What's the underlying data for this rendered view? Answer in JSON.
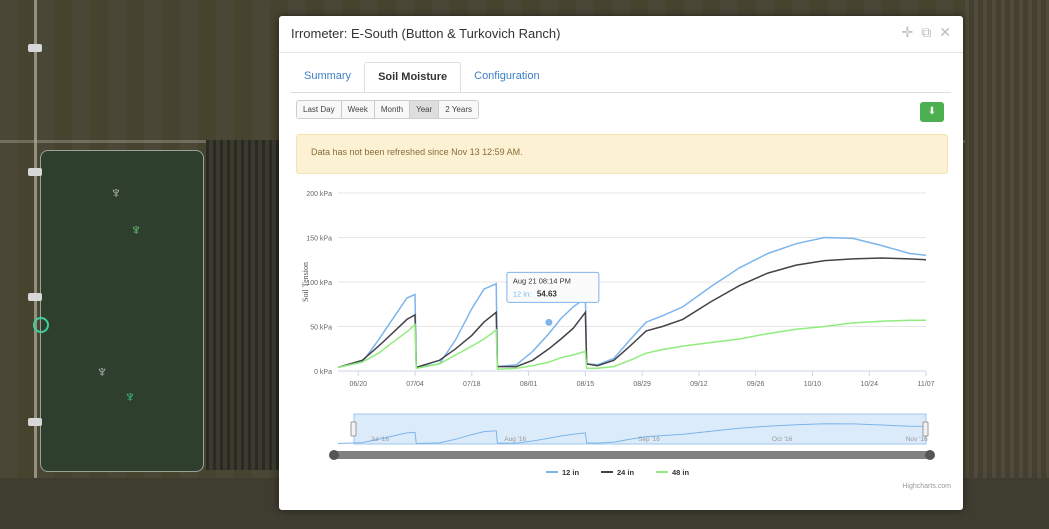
{
  "modal": {
    "title": "Irrometer: E-South (Button & Turkovich Ranch)",
    "actions": [
      {
        "name": "move-icon",
        "glyph": "✛"
      },
      {
        "name": "copy-icon",
        "glyph": "⧉"
      },
      {
        "name": "close-icon",
        "glyph": "✕"
      }
    ]
  },
  "tabs": [
    {
      "label": "Summary",
      "active": false
    },
    {
      "label": "Soil Moisture",
      "active": true
    },
    {
      "label": "Configuration",
      "active": false
    }
  ],
  "range_buttons": [
    {
      "label": "Last Day",
      "active": false
    },
    {
      "label": "Week",
      "active": false
    },
    {
      "label": "Month",
      "active": false
    },
    {
      "label": "Year",
      "active": true
    },
    {
      "label": "2 Years",
      "active": false
    }
  ],
  "download_icon": "download-icon",
  "alert": {
    "text": "Data has not been refreshed since Nov 13 12:59 AM."
  },
  "chart_data": {
    "type": "line",
    "ylabel": "Soil Tension",
    "y_ticks": [
      "0 kPa",
      "50 kPa",
      "100 kPa",
      "150 kPa",
      "200 kPa"
    ],
    "ylim": [
      0,
      200
    ],
    "x_ticks": [
      "06/20",
      "07/04",
      "07/18",
      "08/01",
      "08/15",
      "08/29",
      "09/12",
      "09/26",
      "10/10",
      "10/24",
      "11/07"
    ],
    "series": [
      {
        "name": "12 in",
        "color": "#7cb5ec",
        "points": [
          [
            0,
            4
          ],
          [
            6,
            10
          ],
          [
            10,
            35
          ],
          [
            14,
            62
          ],
          [
            17,
            82
          ],
          [
            19,
            86
          ],
          [
            19.3,
            4
          ],
          [
            25,
            8
          ],
          [
            29,
            35
          ],
          [
            33,
            70
          ],
          [
            36,
            92
          ],
          [
            39,
            98
          ],
          [
            39.3,
            5
          ],
          [
            44,
            7
          ],
          [
            48,
            22
          ],
          [
            52,
            42
          ],
          [
            55,
            59
          ],
          [
            58,
            72
          ],
          [
            61,
            82
          ],
          [
            61.3,
            8
          ],
          [
            64,
            7
          ],
          [
            68,
            14
          ],
          [
            72,
            35
          ],
          [
            76,
            55
          ],
          [
            80,
            62
          ],
          [
            85,
            72
          ],
          [
            92,
            95
          ],
          [
            99,
            116
          ],
          [
            106,
            132
          ],
          [
            113,
            143
          ],
          [
            120,
            150
          ],
          [
            127,
            149
          ],
          [
            134,
            141
          ],
          [
            141,
            132
          ],
          [
            145,
            130
          ]
        ]
      },
      {
        "name": "24 in",
        "color": "#434348",
        "points": [
          [
            0,
            4
          ],
          [
            6,
            12
          ],
          [
            10,
            28
          ],
          [
            14,
            45
          ],
          [
            17,
            58
          ],
          [
            19,
            63
          ],
          [
            19.3,
            4
          ],
          [
            25,
            12
          ],
          [
            29,
            25
          ],
          [
            33,
            40
          ],
          [
            36,
            55
          ],
          [
            39,
            66
          ],
          [
            39.3,
            5
          ],
          [
            44,
            5
          ],
          [
            48,
            12
          ],
          [
            52,
            25
          ],
          [
            55,
            36
          ],
          [
            58,
            48
          ],
          [
            61,
            66
          ],
          [
            61.3,
            8
          ],
          [
            64,
            6
          ],
          [
            68,
            12
          ],
          [
            72,
            28
          ],
          [
            76,
            45
          ],
          [
            80,
            50
          ],
          [
            85,
            58
          ],
          [
            92,
            78
          ],
          [
            99,
            96
          ],
          [
            106,
            110
          ],
          [
            113,
            119
          ],
          [
            120,
            124
          ],
          [
            127,
            126
          ],
          [
            134,
            127
          ],
          [
            141,
            126
          ],
          [
            145,
            125
          ]
        ]
      },
      {
        "name": "48 in",
        "color": "#90ed7d",
        "points": [
          [
            0,
            4
          ],
          [
            6,
            10
          ],
          [
            10,
            20
          ],
          [
            14,
            34
          ],
          [
            17,
            44
          ],
          [
            19,
            52
          ],
          [
            19.3,
            3
          ],
          [
            25,
            8
          ],
          [
            29,
            18
          ],
          [
            33,
            28
          ],
          [
            36,
            36
          ],
          [
            39,
            46
          ],
          [
            39.3,
            2
          ],
          [
            44,
            3
          ],
          [
            48,
            6
          ],
          [
            52,
            10
          ],
          [
            55,
            15
          ],
          [
            58,
            18
          ],
          [
            61,
            22
          ],
          [
            61.3,
            3
          ],
          [
            64,
            3
          ],
          [
            68,
            5
          ],
          [
            72,
            12
          ],
          [
            76,
            20
          ],
          [
            80,
            24
          ],
          [
            85,
            28
          ],
          [
            92,
            32
          ],
          [
            99,
            36
          ],
          [
            106,
            42
          ],
          [
            113,
            47
          ],
          [
            120,
            50
          ],
          [
            127,
            54
          ],
          [
            134,
            56
          ],
          [
            141,
            57
          ],
          [
            145,
            57
          ]
        ]
      }
    ],
    "tooltip": {
      "title": "Aug 21 08:14 PM",
      "series": "12 in",
      "value": "54.63",
      "x": 52,
      "y": 54.63
    },
    "navigator": {
      "labels": [
        "Jul '16",
        "Aug '16",
        "Sep '16",
        "Oct '16",
        "Nov '16"
      ],
      "selected_range": "full"
    },
    "legend_position": "bottom-center"
  },
  "credit": "Highcharts.com"
}
